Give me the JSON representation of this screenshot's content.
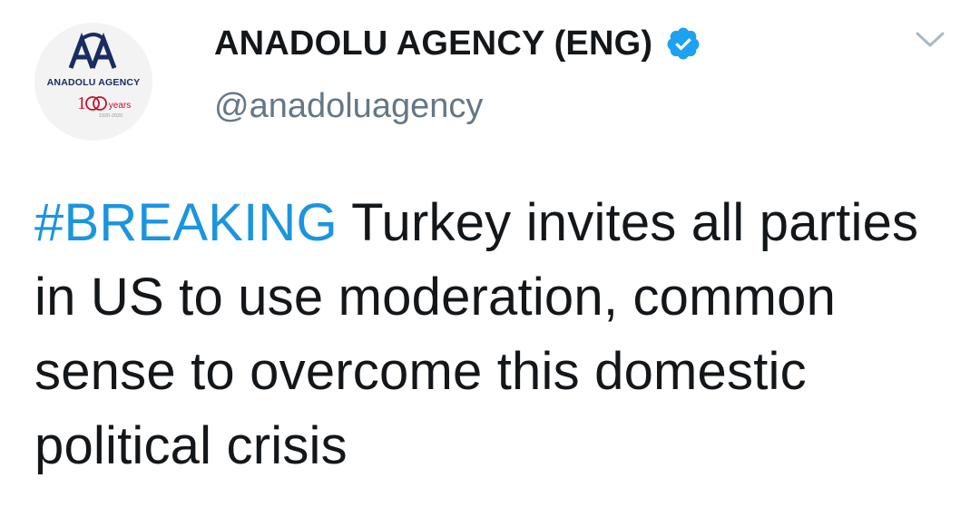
{
  "account": {
    "display_name": "ANADOLU AGENCY (ENG)",
    "handle": "@anadoluagency",
    "verified": true,
    "avatar_logo": {
      "monogram": "AA",
      "wordmark": "ANADOLU AGENCY",
      "anniversary": "100 years",
      "years": "1920-2020"
    }
  },
  "tweet": {
    "hashtag": "#BREAKING",
    "text": " Turkey invites all parties in US to use moderation, common sense to overcome this domestic political crisis"
  },
  "icons": {
    "verified": "verified-badge-icon",
    "menu": "chevron-down-icon"
  },
  "colors": {
    "hashtag": "#1b95e0",
    "verified_badge": "#1da1f2",
    "handle": "#657786",
    "text": "#14171a",
    "logo_blue": "#1a2b63",
    "logo_red": "#c8102e"
  }
}
